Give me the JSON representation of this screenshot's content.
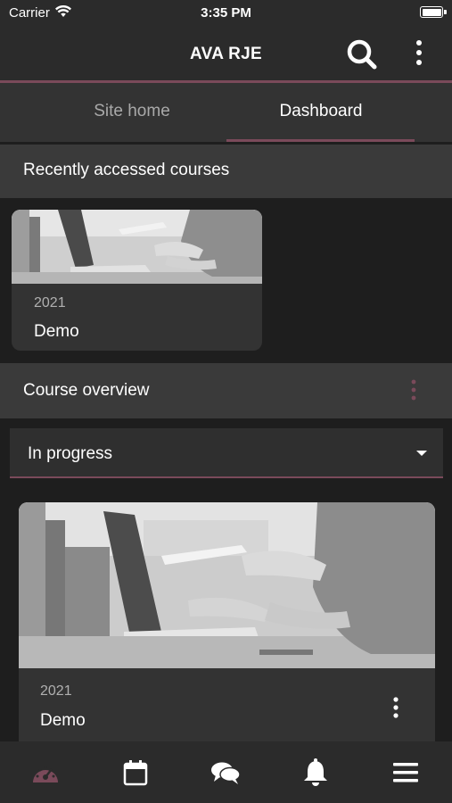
{
  "status_bar": {
    "carrier": "Carrier",
    "time": "3:35 PM"
  },
  "app_bar": {
    "title": "AVA RJE",
    "search_icon": "search-icon",
    "menu_icon": "more-vertical-icon"
  },
  "tabs": [
    {
      "label": "Site home",
      "active": false
    },
    {
      "label": "Dashboard",
      "active": true
    }
  ],
  "recent": {
    "title": "Recently accessed courses",
    "courses": [
      {
        "year": "2021",
        "name": "Demo"
      }
    ]
  },
  "overview": {
    "title": "Course overview",
    "filter": {
      "selected": "In progress"
    },
    "courses": [
      {
        "year": "2021",
        "name": "Demo"
      }
    ]
  },
  "bottom_nav": [
    {
      "icon": "dashboard-icon",
      "active": true
    },
    {
      "icon": "calendar-icon",
      "active": false
    },
    {
      "icon": "messages-icon",
      "active": false
    },
    {
      "icon": "notifications-bell-icon",
      "active": false
    },
    {
      "icon": "menu-icon",
      "active": false
    }
  ],
  "colors": {
    "accent": "#7a4a5a",
    "background": "#1e1e1e",
    "bar": "#2b2b2b",
    "section": "#3a3a3a",
    "card": "#333333"
  }
}
